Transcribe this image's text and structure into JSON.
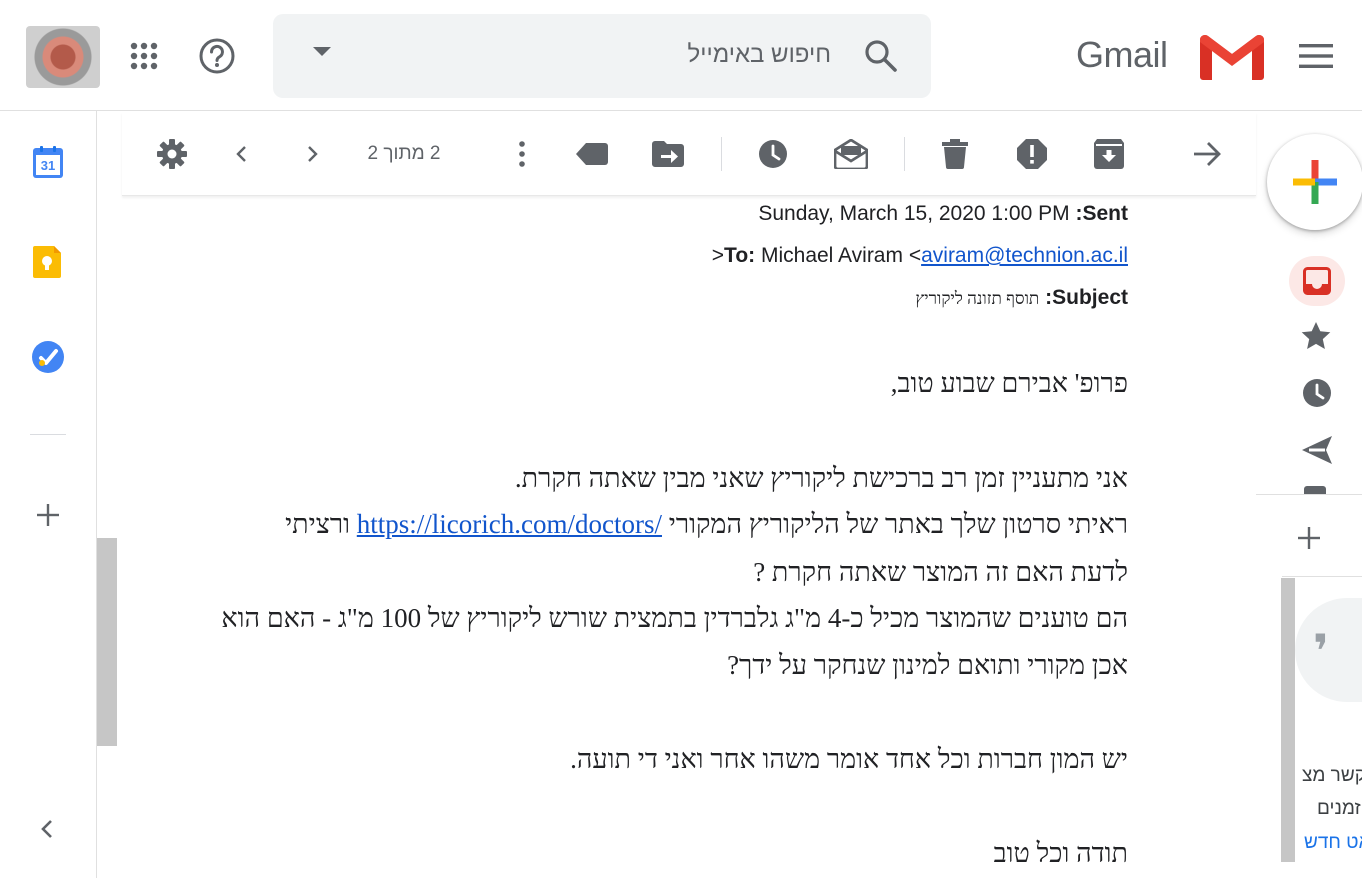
{
  "header": {
    "search_placeholder": "חיפוש באימייל",
    "product_name": "Gmail"
  },
  "toolbar": {
    "page_count": "2 מתוך 2"
  },
  "message": {
    "sent_label": "Sent:",
    "sent_value": "Sunday, March 15, 2020 1:00 PM",
    "to_label": "To:",
    "to_name": "Michael Aviram <",
    "to_email": "aviram@technion.ac.il",
    "to_suffix": ">",
    "subject_label": "Subject:",
    "subject_value": "תוסף תזונה ליקוריץ",
    "greeting": "פרופ' אבירם שבוע טוב,",
    "line1": "אני מתעניין זמן רב ברכישת ליקוריץ שאני מבין שאתה חקרת.",
    "line2_before_link": "ראיתי סרטון שלך באתר של הליקוריץ המקורי",
    "line2_link": "https://licorich.com/doctors/",
    "line2_after_link": "ורציתי",
    "line3": "לדעת האם זה המוצר שאתה חקרת ?",
    "line4": "הם טוענים שהמוצר מכיל כ-4 מ\"ג גלברדין בתמצית שורש ליקוריץ של 100 מ\"ג - האם הוא",
    "line5": "אכן מקורי ותואם למינון שנחקר על ידך?",
    "line6": "יש המון חברות וכל אחד אומר משהו אחר ואני די תועה.",
    "closing": "תודה וכל טוב"
  },
  "left_rail": {
    "calendar_day": "31"
  },
  "right_rail": {
    "chat_line1": "אנשי קשר מצ",
    "chat_line2": "מוזמנים",
    "chat_link": "צ'אט חדש"
  },
  "colors": {
    "link": "#1155cc",
    "compose_red": "#ea4335",
    "compose_blue": "#4285f4",
    "compose_yellow": "#fbbc04",
    "compose_green": "#34a853",
    "inbox_red": "#d93025"
  }
}
